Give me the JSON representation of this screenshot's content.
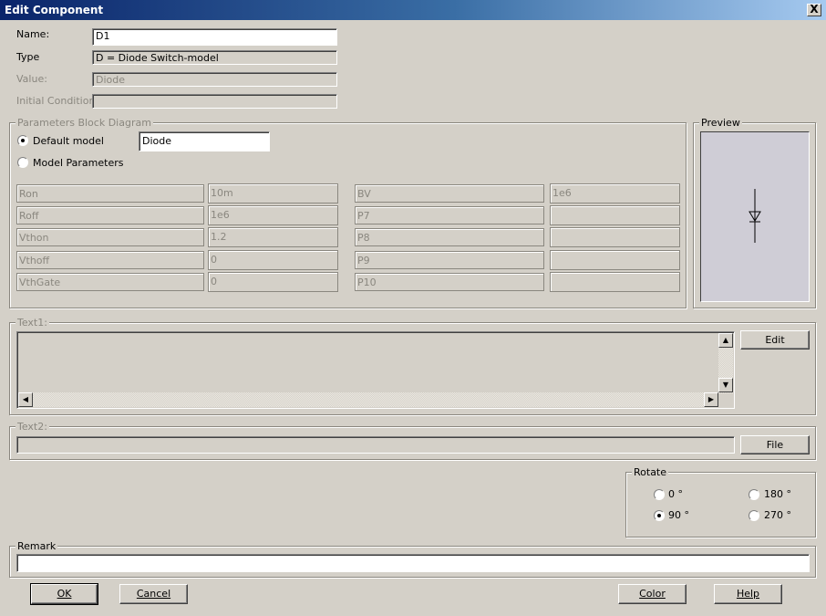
{
  "window": {
    "title": "Edit Component",
    "close_glyph": "X"
  },
  "fields": {
    "name_label": "Name:",
    "name_value": "D1",
    "type_label": "Type",
    "type_value": "D = Diode Switch-model",
    "value_label": "Value:",
    "value_value": "Diode",
    "ic_label": "Initial Condition:",
    "ic_value": ""
  },
  "params_block": {
    "title": "Parameters Block Diagram",
    "default_model_label": "Default model",
    "default_model_value": "Diode",
    "model_params_label": "Model Parameters",
    "selected": "Default model",
    "left": [
      {
        "name": "Ron",
        "value": "10m"
      },
      {
        "name": "Roff",
        "value": "1e6"
      },
      {
        "name": "Vthon",
        "value": "1.2"
      },
      {
        "name": "Vthoff",
        "value": "0"
      },
      {
        "name": "VthGate",
        "value": "0"
      }
    ],
    "right": [
      {
        "name": "BV",
        "value": "1e6"
      },
      {
        "name": "P7",
        "value": ""
      },
      {
        "name": "P8",
        "value": ""
      },
      {
        "name": "P9",
        "value": ""
      },
      {
        "name": "P10",
        "value": ""
      }
    ]
  },
  "preview": {
    "title": "Preview",
    "symbol": "diode-symbol-icon"
  },
  "text1": {
    "label": "Text1:",
    "value": "",
    "edit_button": "Edit"
  },
  "text2": {
    "label": "Text2:",
    "value": "",
    "file_button": "File"
  },
  "rotate": {
    "title": "Rotate",
    "options": [
      "0 °",
      "90 °",
      "180 °",
      "270 °"
    ],
    "selected": "90 °"
  },
  "remark": {
    "label": "Remark",
    "value": ""
  },
  "buttons": {
    "ok": "OK",
    "cancel": "Cancel",
    "color": "Color",
    "help": "Help"
  },
  "colors": {
    "titlebar_start": "#0a246a",
    "titlebar_end": "#a6caf0",
    "face": "#d4d0c8"
  }
}
